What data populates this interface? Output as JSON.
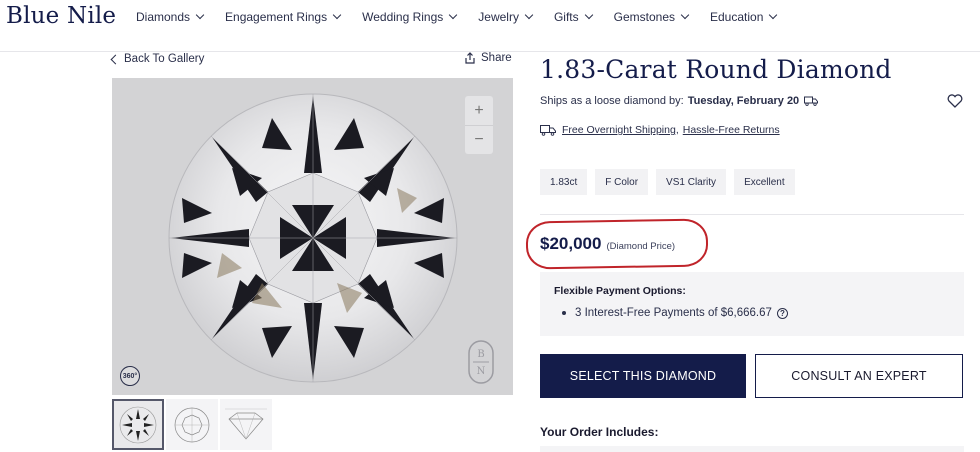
{
  "brand": {
    "logo": "Blue Nile"
  },
  "nav": {
    "items": [
      {
        "label": "Diamonds"
      },
      {
        "label": "Engagement Rings"
      },
      {
        "label": "Wedding Rings"
      },
      {
        "label": "Jewelry"
      },
      {
        "label": "Gifts"
      },
      {
        "label": "Gemstones"
      },
      {
        "label": "Education"
      }
    ]
  },
  "gallery": {
    "back_label": "Back To Gallery",
    "share_label": "Share",
    "zoom_in": "+",
    "zoom_out": "−",
    "badge_360": "360°",
    "bn_mark_top": "B",
    "bn_mark_bottom": "N"
  },
  "product": {
    "title": "1.83-Carat Round Diamond",
    "ships_prefix": "Ships as a loose diamond by:",
    "ships_date": "Tuesday, February 20",
    "shipping_link_1": "Free Overnight Shipping",
    "shipping_sep": ",",
    "shipping_link_2": "Hassle-Free Returns",
    "chips": [
      {
        "label": "1.83ct"
      },
      {
        "label": "F Color"
      },
      {
        "label": "VS1 Clarity"
      },
      {
        "label": "Excellent"
      }
    ],
    "price": "$20,000",
    "price_label": "(Diamond Price)",
    "payment": {
      "heading": "Flexible Payment Options:",
      "item": "3 Interest-Free Payments of $6,666.67",
      "help": "?"
    },
    "select_button": "SELECT THIS DIAMOND",
    "consult_button": "CONSULT AN EXPERT",
    "order_heading": "Your Order Includes:"
  },
  "colors": {
    "brand_navy": "#141c4a",
    "highlight_red": "#c0242a",
    "panel_gray": "#f4f4f6"
  }
}
